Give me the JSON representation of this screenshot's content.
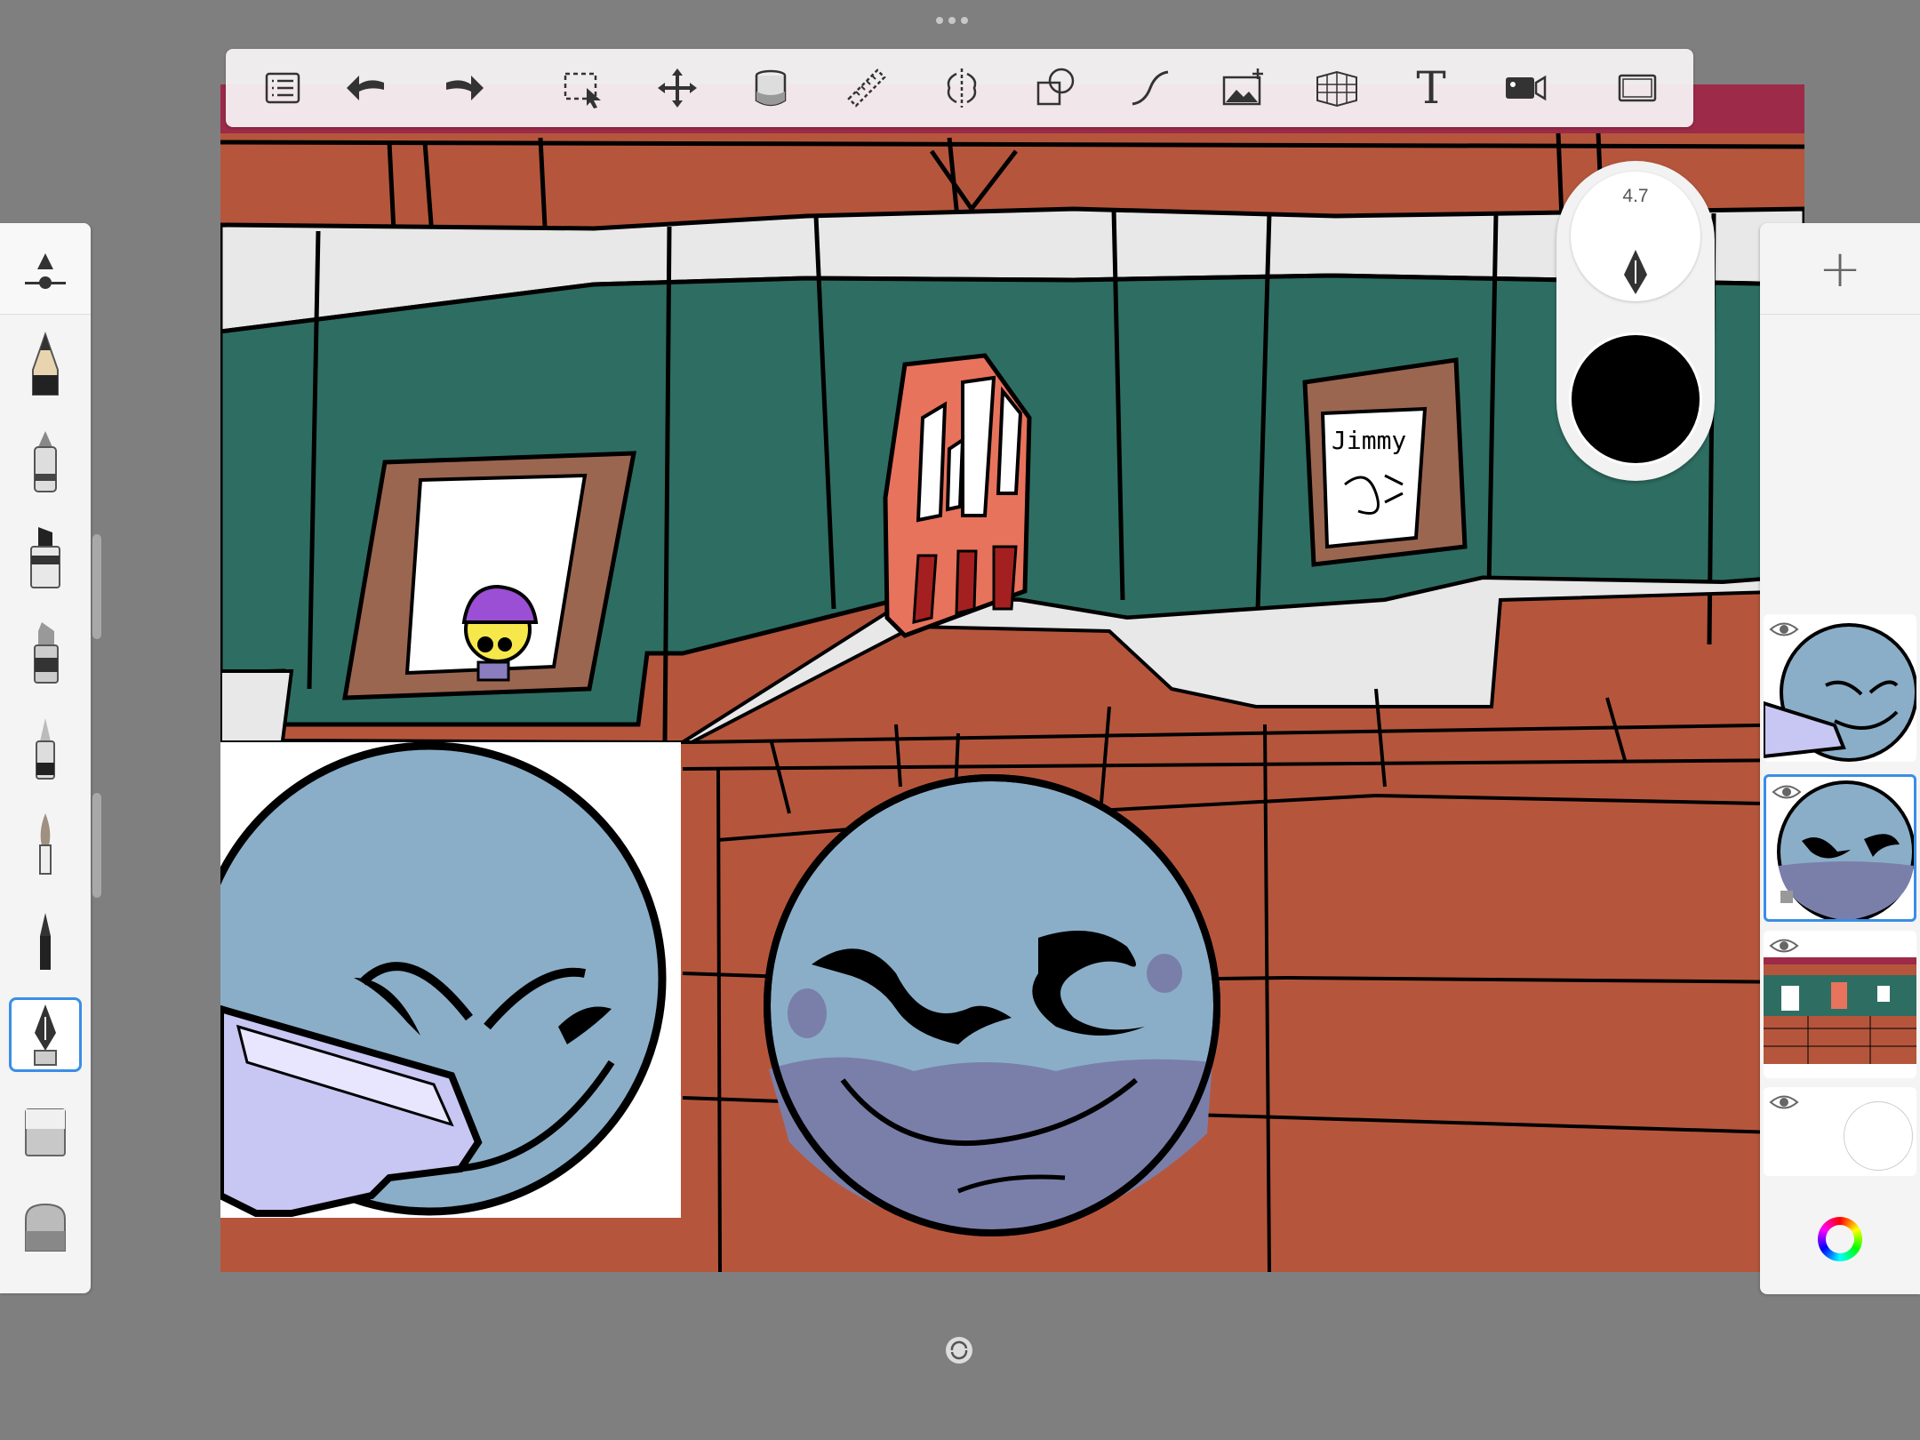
{
  "app": {
    "handle": "more-options"
  },
  "toolbar": {
    "tools": [
      {
        "name": "layers-list",
        "icon": "list-icon"
      },
      {
        "name": "undo",
        "icon": "undo-icon"
      },
      {
        "name": "redo",
        "icon": "redo-icon"
      },
      {
        "name": "selection",
        "icon": "selection-icon"
      },
      {
        "name": "transform",
        "icon": "move-icon"
      },
      {
        "name": "fill",
        "icon": "paint-bucket-icon"
      },
      {
        "name": "ruler",
        "icon": "ruler-icon"
      },
      {
        "name": "symmetry",
        "icon": "symmetry-icon"
      },
      {
        "name": "shapes",
        "icon": "shapes-icon"
      },
      {
        "name": "stroke",
        "icon": "curve-icon"
      },
      {
        "name": "import-image",
        "icon": "image-add-icon"
      },
      {
        "name": "perspective",
        "icon": "perspective-grid-icon"
      },
      {
        "name": "text",
        "icon": "text-icon"
      },
      {
        "name": "time-lapse",
        "icon": "video-camera-icon"
      },
      {
        "name": "fullscreen",
        "icon": "fullscreen-icon"
      }
    ],
    "text_tool_label": "T"
  },
  "brush_panel": {
    "brushes": [
      "pencil",
      "ballpoint-pen",
      "marker",
      "chisel-marker",
      "fineliner",
      "paintbrush",
      "airbrush",
      "fountain-pen",
      "soft-eraser",
      "hard-eraser"
    ],
    "selected_brush": "fountain-pen"
  },
  "brush_puck": {
    "size_value": "4.7",
    "color": "#000000"
  },
  "layers_panel": {
    "add_label": "+",
    "layers": [
      {
        "name": "character-with-gun",
        "visible": true,
        "selected": false
      },
      {
        "name": "character-face",
        "visible": true,
        "selected": true
      },
      {
        "name": "background-scene",
        "visible": true,
        "selected": false
      },
      {
        "name": "background-white",
        "visible": true,
        "selected": false
      }
    ]
  },
  "canvas": {
    "sign_text": "Jimmy",
    "colors": {
      "wood": "#b5563c",
      "wall_green": "#2e6e62",
      "trim_white": "#e8e8e8",
      "door": "#e8735c",
      "frame_brown": "#9b6650",
      "face_blue": "#8aaec8",
      "face_shadow": "#7a7faa",
      "maroon_top": "#9c2a48"
    }
  }
}
